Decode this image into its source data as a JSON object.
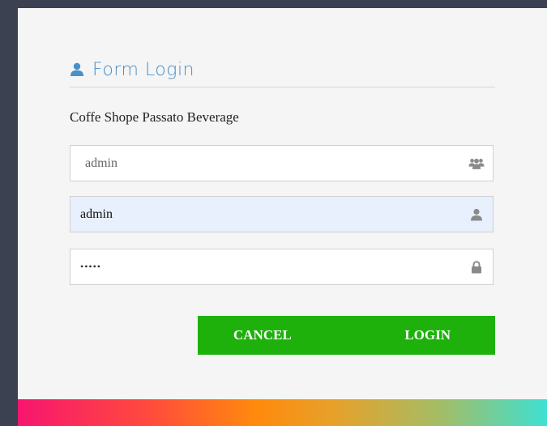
{
  "form": {
    "title": "Form Login",
    "subtitle": "Coffe Shope Passato Beverage",
    "fields": [
      {
        "value": "admin",
        "icon": "users-icon"
      },
      {
        "value": "admin",
        "icon": "user-icon"
      },
      {
        "value": "•••••",
        "icon": "lock-icon"
      }
    ],
    "buttons": {
      "cancel": "CANCEL",
      "login": "LOGIN"
    }
  },
  "colors": {
    "accent": "#4a90c8",
    "button": "#1eb10c",
    "autofill": "#e8f0fe",
    "frame": "#3b4150"
  }
}
